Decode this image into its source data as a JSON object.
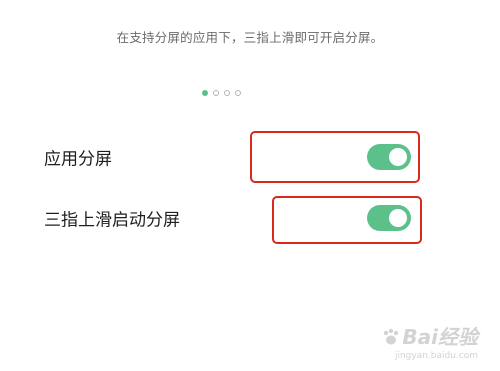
{
  "hint": {
    "text": "在支持分屏的应用下，三指上滑即可开启分屏。"
  },
  "pagination": {
    "count": 4,
    "active_index": 0
  },
  "settings": [
    {
      "label": "应用分屏",
      "enabled": true
    },
    {
      "label": "三指上滑启动分屏",
      "enabled": true
    }
  ],
  "watermark": {
    "logo_text": "Bai经验",
    "url": "jingyan.baidu.com"
  },
  "colors": {
    "accent": "#5cc08a",
    "highlight": "#d9291c",
    "background": "#ffffff"
  }
}
